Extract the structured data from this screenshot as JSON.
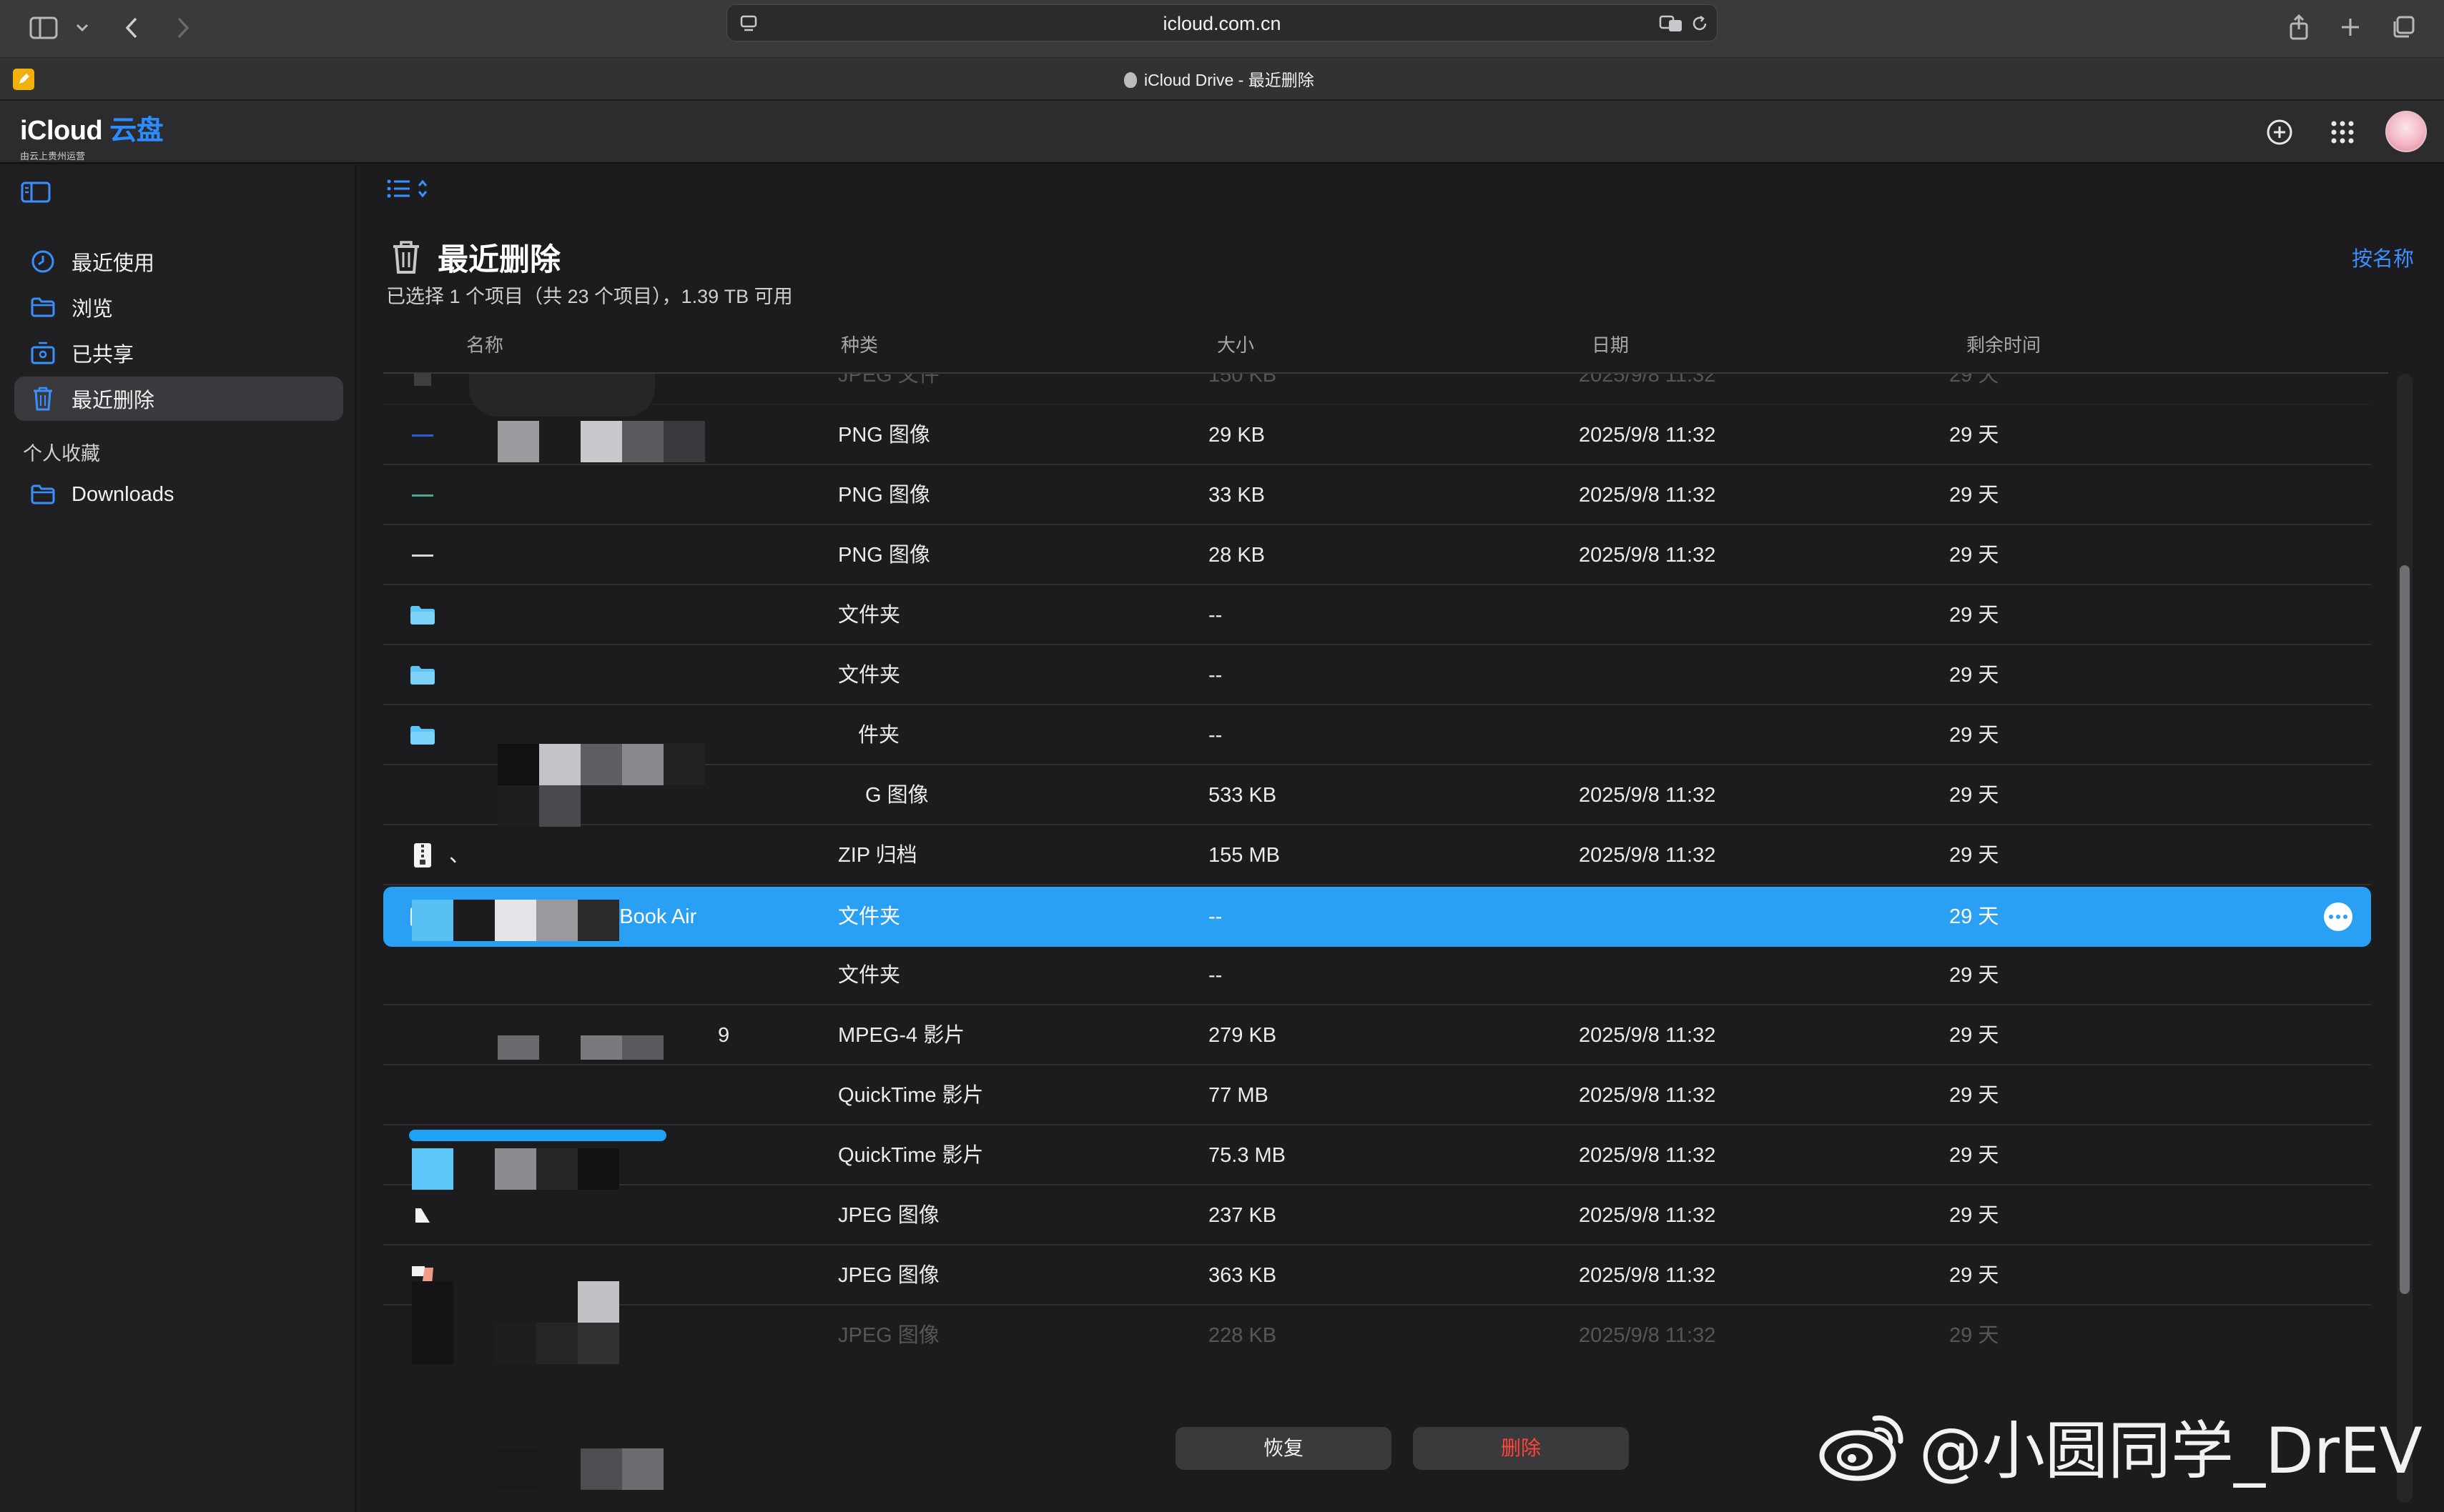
{
  "browser": {
    "url": "icloud.com.cn",
    "tab_title": "iCloud Drive - 最近删除"
  },
  "app": {
    "brand": "iCloud",
    "brand_accent": "云盘",
    "brand_sub": "由云上贵州运营"
  },
  "sidebar": {
    "items": [
      {
        "label": "最近使用",
        "icon": "clock-icon"
      },
      {
        "label": "浏览",
        "icon": "folder-icon"
      },
      {
        "label": "已共享",
        "icon": "shared-folder-icon"
      },
      {
        "label": "最近删除",
        "icon": "trash-icon"
      }
    ],
    "section_label": "个人收藏",
    "favorites": [
      {
        "label": "Downloads",
        "icon": "folder-icon"
      }
    ]
  },
  "main": {
    "title": "最近删除",
    "subtitle": "已选择 1 个项目（共 23 个项目），1.39 TB 可用",
    "sort_label": "按名称",
    "columns": [
      "名称",
      "种类",
      "大小",
      "日期",
      "剩余时间"
    ],
    "rows": [
      {
        "name": "",
        "kind": "JPEG 文件",
        "size": "150 KB",
        "date": "2025/9/8 11:32",
        "remaining": "29 天",
        "icon": "image-file-icon"
      },
      {
        "name": "l (1)",
        "kind": "PNG 图像",
        "size": "29 KB",
        "date": "2025/9/8 11:32",
        "remaining": "29 天",
        "icon": "image-file-icon"
      },
      {
        "name": "",
        "kind": "PNG 图像",
        "size": "33 KB",
        "date": "2025/9/8 11:32",
        "remaining": "29 天",
        "icon": "image-file-icon"
      },
      {
        "name": "",
        "kind": "PNG 图像",
        "size": "28 KB",
        "date": "2025/9/8 11:32",
        "remaining": "29 天",
        "icon": "image-file-icon"
      },
      {
        "name": "",
        "kind": "文件夹",
        "size": "--",
        "date": "",
        "remaining": "29 天",
        "icon": "folder-icon"
      },
      {
        "name": "",
        "kind": "文件夹",
        "size": "--",
        "date": "",
        "remaining": "29 天",
        "icon": "folder-icon"
      },
      {
        "name": "",
        "kind": "件夹",
        "size": "--",
        "date": "",
        "remaining": "29 天",
        "icon": "folder-icon"
      },
      {
        "name": "",
        "kind": "G 图像",
        "size": "533 KB",
        "date": "2025/9/8 11:32",
        "remaining": "29 天",
        "icon": "image-file-icon"
      },
      {
        "name": "、",
        "kind": "ZIP 归档",
        "size": "155 MB",
        "date": "2025/9/8 11:32",
        "remaining": "29 天",
        "icon": "zip-file-icon"
      },
      {
        "name": "桌面 - mia的MacBook Air",
        "kind": "文件夹",
        "size": "--",
        "date": "",
        "remaining": "29 天",
        "icon": "folder-icon"
      },
      {
        "name": "",
        "kind": "文件夹",
        "size": "--",
        "date": "",
        "remaining": "29 天",
        "icon": "folder-icon"
      },
      {
        "name": "9",
        "kind": "MPEG-4 影片",
        "size": "279 KB",
        "date": "2025/9/8 11:32",
        "remaining": "29 天",
        "icon": "video-file-icon"
      },
      {
        "name": "",
        "kind": "QuickTime 影片",
        "size": "77 MB",
        "date": "2025/9/8 11:32",
        "remaining": "29 天",
        "icon": "video-file-icon"
      },
      {
        "name": "",
        "kind": "QuickTime 影片",
        "size": "75.3 MB",
        "date": "2025/9/8 11:32",
        "remaining": "29 天",
        "icon": "video-file-icon"
      },
      {
        "name": "",
        "kind": "JPEG 图像",
        "size": "237 KB",
        "date": "2025/9/8 11:32",
        "remaining": "29 天",
        "icon": "image-file-icon"
      },
      {
        "name": "",
        "kind": "JPEG 图像",
        "size": "363 KB",
        "date": "2025/9/8 11:32",
        "remaining": "29 天",
        "icon": "image-file-icon"
      },
      {
        "name": "",
        "kind": "JPEG 图像",
        "size": "228 KB",
        "date": "2025/9/8 11:32",
        "remaining": "29 天",
        "icon": "image-file-icon"
      }
    ],
    "restore_label": "恢复",
    "delete_label": "删除"
  },
  "watermark": "@小圆同学_DrEV",
  "colors": {
    "accent": "#3a8fff",
    "selected_row": "#2aa0f5",
    "delete": "#ff453a",
    "background": "#1c1c1e"
  }
}
